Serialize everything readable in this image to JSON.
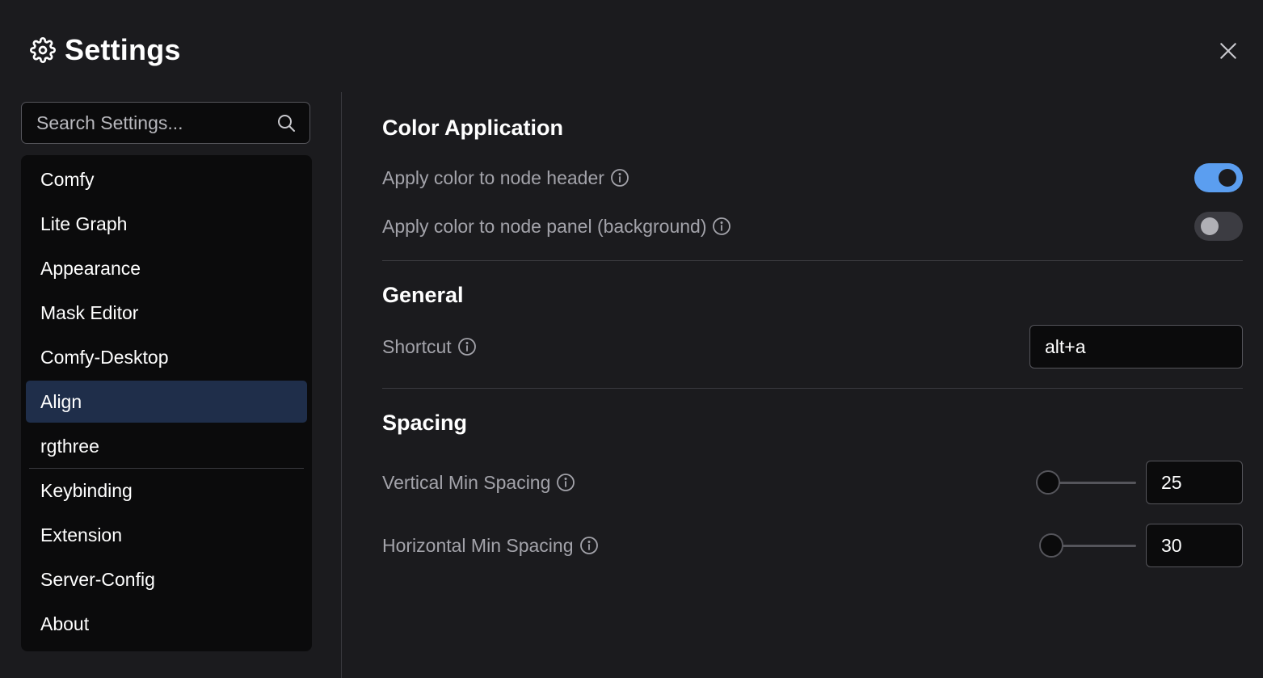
{
  "dialog": {
    "title": "Settings",
    "title_icon": "gear-icon",
    "close_icon": "close-icon"
  },
  "search": {
    "placeholder": "Search Settings...",
    "value": "",
    "icon": "search-icon"
  },
  "sidebar": {
    "items": [
      {
        "label": "Comfy",
        "active": false
      },
      {
        "label": "Lite Graph",
        "active": false
      },
      {
        "label": "Appearance",
        "active": false
      },
      {
        "label": "Mask Editor",
        "active": false
      },
      {
        "label": "Comfy-Desktop",
        "active": false
      },
      {
        "label": "Align",
        "active": true
      },
      {
        "label": "rgthree",
        "active": false
      },
      {
        "label": "Keybinding",
        "active": false
      },
      {
        "label": "Extension",
        "active": false
      },
      {
        "label": "Server-Config",
        "active": false
      },
      {
        "label": "About",
        "active": false
      }
    ]
  },
  "sections": {
    "color_application": {
      "title": "Color Application",
      "settings": [
        {
          "label": "Apply color to node header",
          "enabled": true
        },
        {
          "label": "Apply color to node panel (background)",
          "enabled": false
        }
      ]
    },
    "general": {
      "title": "General",
      "shortcut": {
        "label": "Shortcut",
        "value": "alt+a"
      }
    },
    "spacing": {
      "title": "Spacing",
      "vertical": {
        "label": "Vertical Min Spacing",
        "value": "25",
        "slider_fraction": 0.0
      },
      "horizontal": {
        "label": "Horizontal Min Spacing",
        "value": "30",
        "slider_fraction": 0.0
      }
    }
  },
  "colors": {
    "background": "#1b1b1e",
    "panel": "#0b0b0c",
    "accent": "#5b9ef0",
    "active_item": "#1f2e4a",
    "muted_text": "#a3a3aa"
  }
}
